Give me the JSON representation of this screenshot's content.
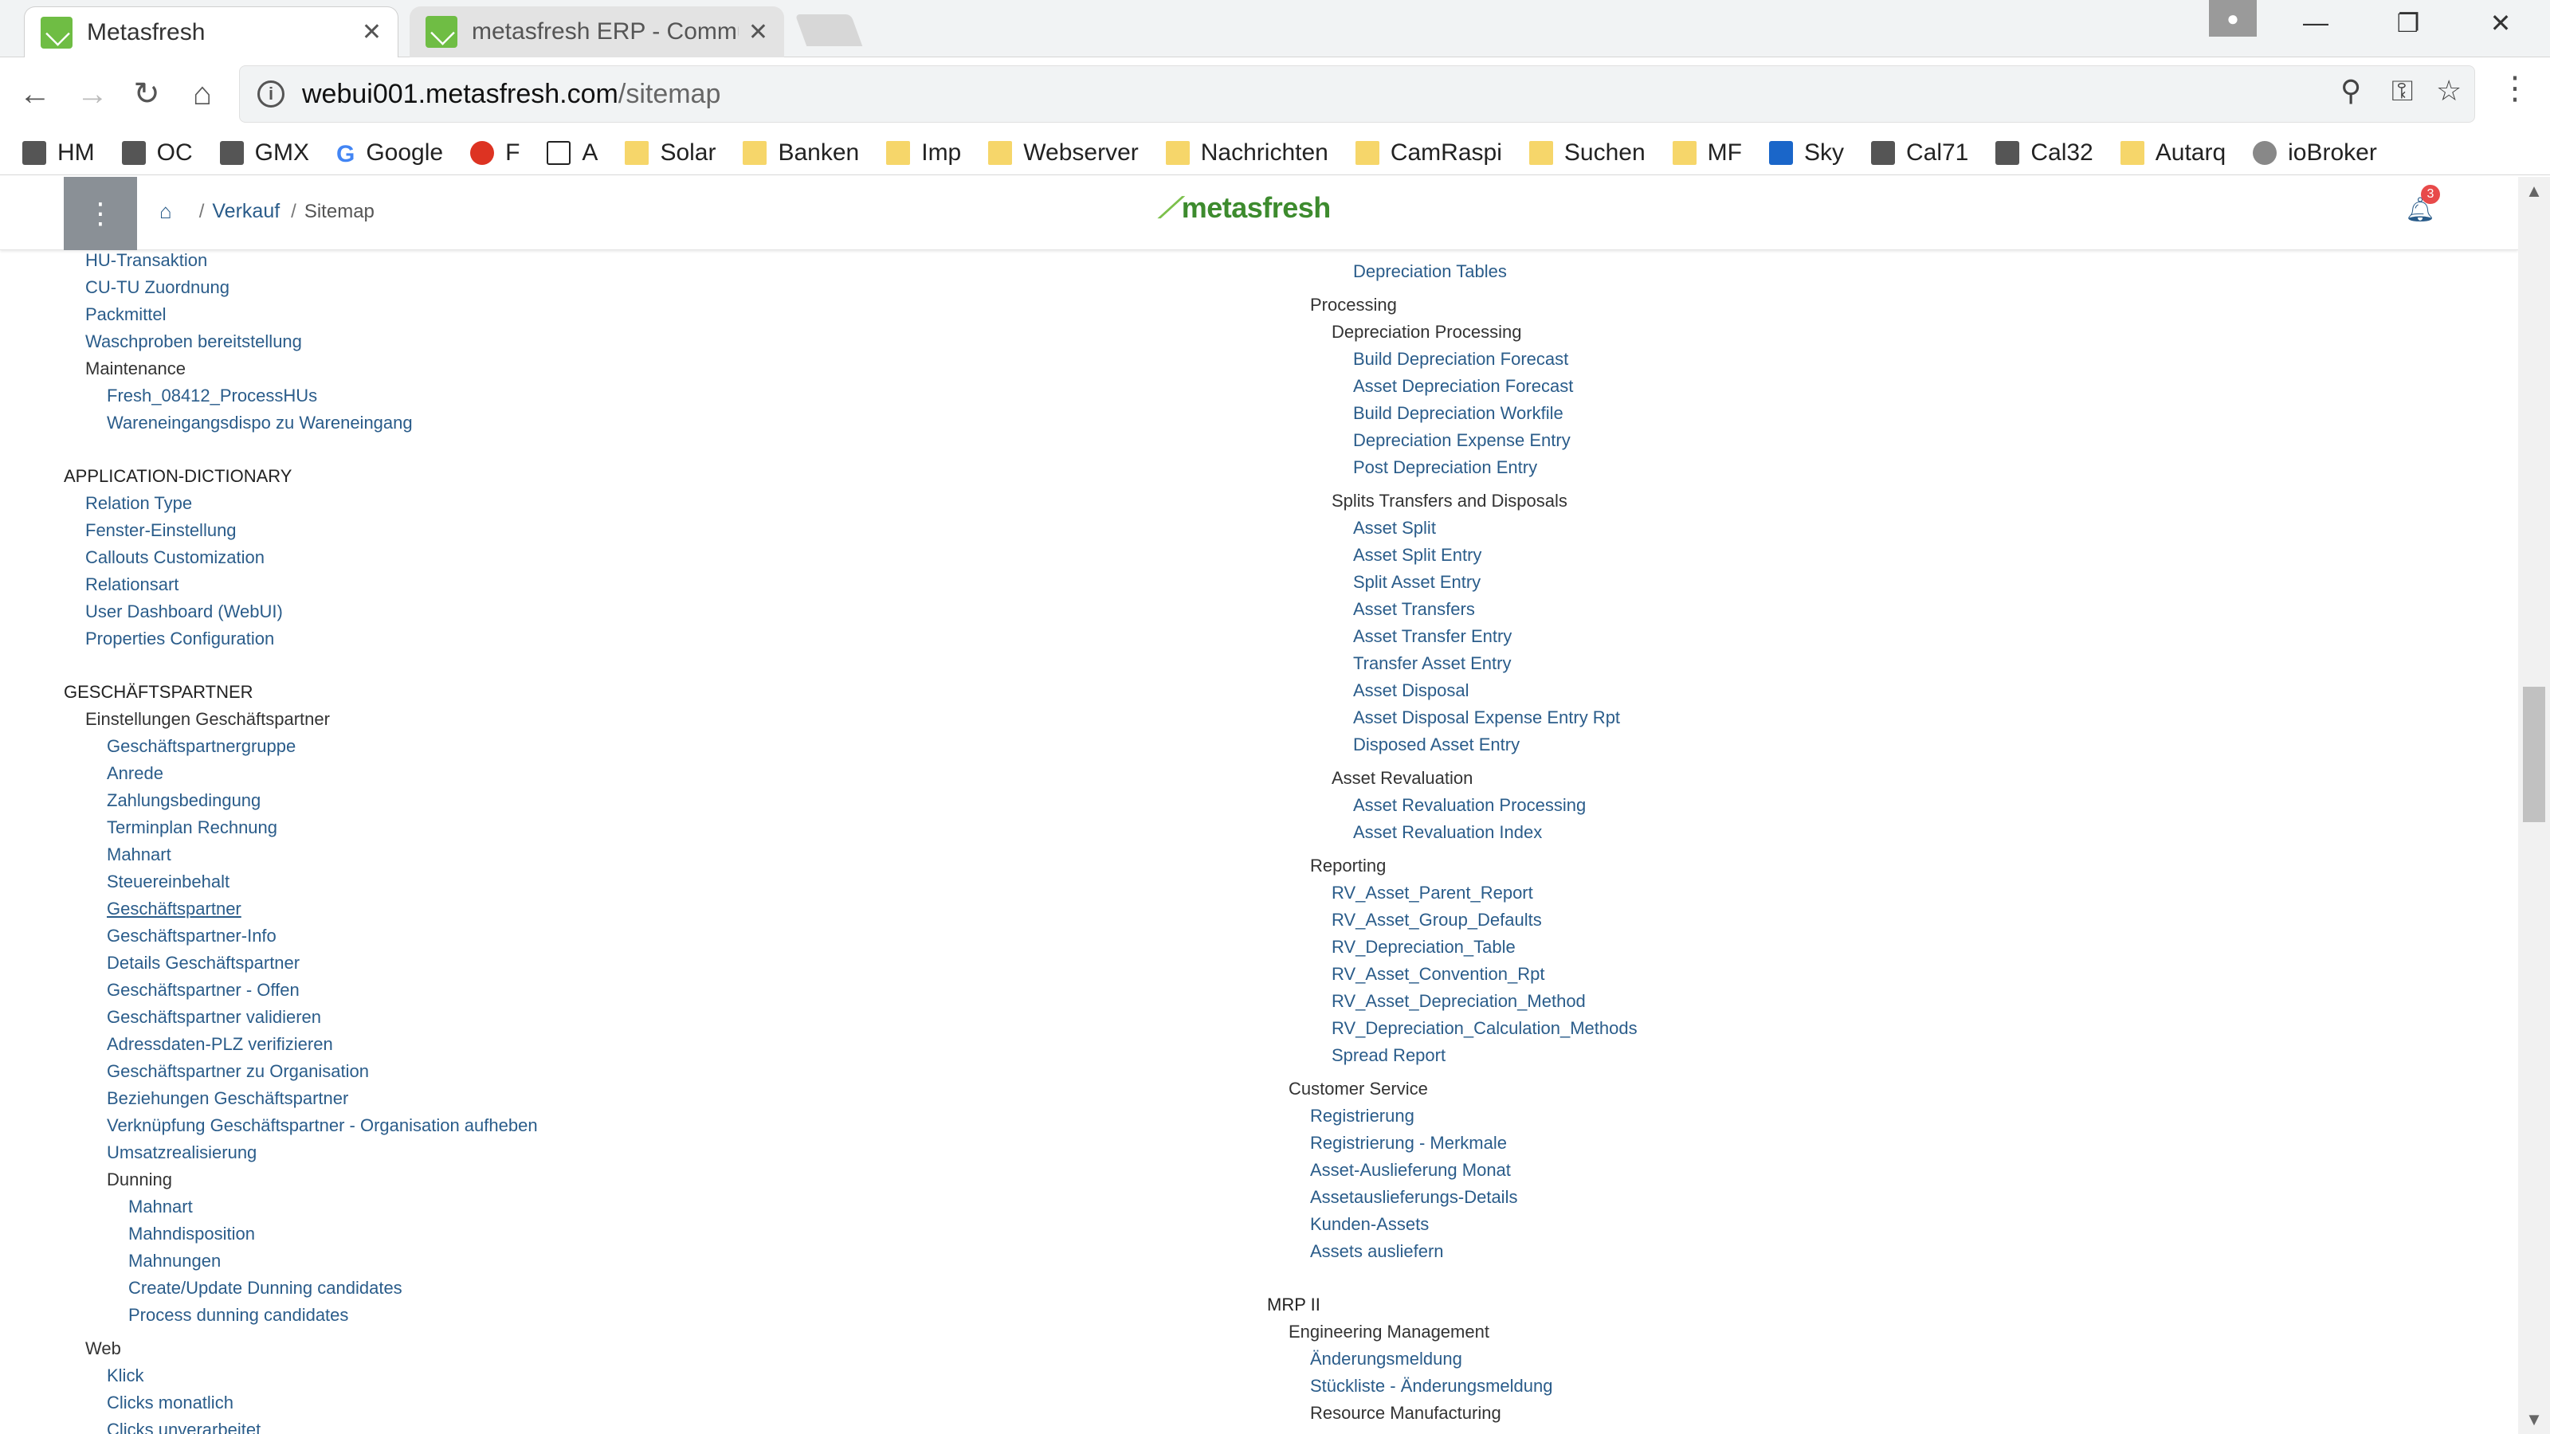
{
  "browser": {
    "tabs": [
      {
        "title": "Metasfresh"
      },
      {
        "title": "metasfresh ERP - Commu"
      }
    ],
    "url_host": "webui001.metasfresh.com",
    "url_path": "/sitemap",
    "bookmarks": [
      {
        "label": "HM",
        "icon": "file-icon"
      },
      {
        "label": "OC",
        "icon": "cloud-icon"
      },
      {
        "label": "GMX",
        "icon": "gmx-icon"
      },
      {
        "label": "Google",
        "icon": "google-icon"
      },
      {
        "label": "F",
        "icon": "fritz-icon"
      },
      {
        "label": "A",
        "icon": "amazon-icon"
      },
      {
        "label": "Solar",
        "icon": "folder-icon"
      },
      {
        "label": "Banken",
        "icon": "folder-icon"
      },
      {
        "label": "Imp",
        "icon": "folder-icon"
      },
      {
        "label": "Webserver",
        "icon": "folder-icon"
      },
      {
        "label": "Nachrichten",
        "icon": "folder-icon"
      },
      {
        "label": "CamRaspi",
        "icon": "folder-icon"
      },
      {
        "label": "Suchen",
        "icon": "folder-icon"
      },
      {
        "label": "MF",
        "icon": "folder-icon"
      },
      {
        "label": "Sky",
        "icon": "sky-icon"
      },
      {
        "label": "Cal71",
        "icon": "calibre-icon"
      },
      {
        "label": "Cal32",
        "icon": "calibre-icon"
      },
      {
        "label": "Autarq",
        "icon": "folder-icon"
      },
      {
        "label": "ioBroker",
        "icon": "gear-icon"
      }
    ]
  },
  "app": {
    "brand": "metasfresh",
    "breadcrumb": {
      "section": "Verkauf",
      "page": "Sitemap"
    },
    "notification_count": "3"
  },
  "sitemap": {
    "left": [
      {
        "t": "HU-Transaktion",
        "k": "l",
        "lvl": 1
      },
      {
        "t": "CU-TU Zuordnung",
        "k": "l",
        "lvl": 1
      },
      {
        "t": "Packmittel",
        "k": "l",
        "lvl": 1
      },
      {
        "t": "Waschproben bereitstellung",
        "k": "l",
        "lvl": 1
      },
      {
        "t": "Maintenance",
        "k": "g",
        "lvl": 1
      },
      {
        "t": "Fresh_08412_ProcessHUs",
        "k": "l",
        "lvl": 2
      },
      {
        "t": "Wareneingangsdispo zu Wareneingang",
        "k": "l",
        "lvl": 2
      },
      {
        "t": "APPLICATION-DICTIONARY",
        "k": "h",
        "lvl": 0,
        "gap": true
      },
      {
        "t": "Relation Type",
        "k": "l",
        "lvl": 1
      },
      {
        "t": "Fenster-Einstellung",
        "k": "l",
        "lvl": 1
      },
      {
        "t": "Callouts Customization",
        "k": "l",
        "lvl": 1
      },
      {
        "t": "Relationsart",
        "k": "l",
        "lvl": 1
      },
      {
        "t": "User Dashboard (WebUI)",
        "k": "l",
        "lvl": 1
      },
      {
        "t": "Properties Configuration",
        "k": "l",
        "lvl": 1
      },
      {
        "t": "GESCHÄFTSPARTNER",
        "k": "h",
        "lvl": 0,
        "gap": true
      },
      {
        "t": "Einstellungen Geschäftspartner",
        "k": "g",
        "lvl": 1
      },
      {
        "t": "Geschäftspartnergruppe",
        "k": "l",
        "lvl": 2
      },
      {
        "t": "Anrede",
        "k": "l",
        "lvl": 2
      },
      {
        "t": "Zahlungsbedingung",
        "k": "l",
        "lvl": 2
      },
      {
        "t": "Terminplan Rechnung",
        "k": "l",
        "lvl": 2
      },
      {
        "t": "Mahnart",
        "k": "l",
        "lvl": 2
      },
      {
        "t": "Steuereinbehalt",
        "k": "l",
        "lvl": 2
      },
      {
        "t": "Geschäftspartner",
        "k": "l",
        "lvl": 2,
        "u": true
      },
      {
        "t": "Geschäftspartner-Info",
        "k": "l",
        "lvl": 2
      },
      {
        "t": "Details Geschäftspartner",
        "k": "l",
        "lvl": 2
      },
      {
        "t": "Geschäftspartner - Offen",
        "k": "l",
        "lvl": 2
      },
      {
        "t": "Geschäftspartner validieren",
        "k": "l",
        "lvl": 2
      },
      {
        "t": "Adressdaten-PLZ verifizieren",
        "k": "l",
        "lvl": 2
      },
      {
        "t": "Geschäftspartner zu Organisation",
        "k": "l",
        "lvl": 2
      },
      {
        "t": "Beziehungen Geschäftspartner",
        "k": "l",
        "lvl": 2
      },
      {
        "t": "Verknüpfung Geschäftspartner - Organisation aufheben",
        "k": "l",
        "lvl": 2
      },
      {
        "t": "Umsatzrealisierung",
        "k": "l",
        "lvl": 2
      },
      {
        "t": "Dunning",
        "k": "g",
        "lvl": 2
      },
      {
        "t": "Mahnart",
        "k": "l",
        "lvl": 3
      },
      {
        "t": "Mahndisposition",
        "k": "l",
        "lvl": 3
      },
      {
        "t": "Mahnungen",
        "k": "l",
        "lvl": 3
      },
      {
        "t": "Create/Update Dunning candidates",
        "k": "l",
        "lvl": 3
      },
      {
        "t": "Process dunning candidates",
        "k": "l",
        "lvl": 3
      },
      {
        "t": "Web",
        "k": "g",
        "lvl": 1,
        "gap": "small"
      },
      {
        "t": "Klick",
        "k": "l",
        "lvl": 2
      },
      {
        "t": "Clicks monatlich",
        "k": "l",
        "lvl": 2
      },
      {
        "t": "Clicks unverarbeitet",
        "k": "l",
        "lvl": 2
      }
    ],
    "right": [
      {
        "t": "Depreciation Tables",
        "k": "l",
        "lvl": 4
      },
      {
        "t": "Processing",
        "k": "g",
        "lvl": 2,
        "gap": "small"
      },
      {
        "t": "Depreciation Processing",
        "k": "g",
        "lvl": 3
      },
      {
        "t": "Build Depreciation Forecast",
        "k": "l",
        "lvl": 4
      },
      {
        "t": "Asset Depreciation Forecast",
        "k": "l",
        "lvl": 4
      },
      {
        "t": "Build Depreciation Workfile",
        "k": "l",
        "lvl": 4
      },
      {
        "t": "Depreciation Expense Entry",
        "k": "l",
        "lvl": 4
      },
      {
        "t": "Post Depreciation Entry",
        "k": "l",
        "lvl": 4
      },
      {
        "t": "Splits Transfers and Disposals",
        "k": "g",
        "lvl": 3,
        "gap": "small"
      },
      {
        "t": "Asset Split",
        "k": "l",
        "lvl": 4
      },
      {
        "t": "Asset Split Entry",
        "k": "l",
        "lvl": 4
      },
      {
        "t": "Split Asset Entry",
        "k": "l",
        "lvl": 4
      },
      {
        "t": "Asset Transfers",
        "k": "l",
        "lvl": 4
      },
      {
        "t": "Asset Transfer Entry",
        "k": "l",
        "lvl": 4
      },
      {
        "t": "Transfer Asset Entry",
        "k": "l",
        "lvl": 4
      },
      {
        "t": "Asset Disposal",
        "k": "l",
        "lvl": 4
      },
      {
        "t": "Asset Disposal Expense Entry Rpt",
        "k": "l",
        "lvl": 4
      },
      {
        "t": "Disposed Asset Entry",
        "k": "l",
        "lvl": 4
      },
      {
        "t": "Asset Revaluation",
        "k": "g",
        "lvl": 3,
        "gap": "small"
      },
      {
        "t": "Asset Revaluation Processing",
        "k": "l",
        "lvl": 4
      },
      {
        "t": "Asset Revaluation Index",
        "k": "l",
        "lvl": 4
      },
      {
        "t": "Reporting",
        "k": "g",
        "lvl": 2,
        "gap": "small"
      },
      {
        "t": "RV_Asset_Parent_Report",
        "k": "l",
        "lvl": 3
      },
      {
        "t": "RV_Asset_Group_Defaults",
        "k": "l",
        "lvl": 3
      },
      {
        "t": "RV_Depreciation_Table",
        "k": "l",
        "lvl": 3
      },
      {
        "t": "RV_Asset_Convention_Rpt",
        "k": "l",
        "lvl": 3
      },
      {
        "t": "RV_Asset_Depreciation_Method",
        "k": "l",
        "lvl": 3
      },
      {
        "t": "RV_Depreciation_Calculation_Methods",
        "k": "l",
        "lvl": 3
      },
      {
        "t": "Spread Report",
        "k": "l",
        "lvl": 3
      },
      {
        "t": "Customer Service",
        "k": "g",
        "lvl": 1,
        "gap": "small"
      },
      {
        "t": "Registrierung",
        "k": "l",
        "lvl": 2
      },
      {
        "t": "Registrierung - Merkmale",
        "k": "l",
        "lvl": 2
      },
      {
        "t": "Asset-Auslieferung Monat",
        "k": "l",
        "lvl": 2
      },
      {
        "t": "Assetauslieferungs-Details",
        "k": "l",
        "lvl": 2
      },
      {
        "t": "Kunden-Assets",
        "k": "l",
        "lvl": 2
      },
      {
        "t": "Assets ausliefern",
        "k": "l",
        "lvl": 2
      },
      {
        "t": "MRP II",
        "k": "h",
        "lvl": 0,
        "gap": true
      },
      {
        "t": "Engineering Management",
        "k": "g",
        "lvl": 1
      },
      {
        "t": "Änderungsmeldung",
        "k": "l",
        "lvl": 2
      },
      {
        "t": "Stückliste - Änderungsmeldung",
        "k": "l",
        "lvl": 2
      },
      {
        "t": "Resource Manufacturing",
        "k": "g",
        "lvl": 2
      }
    ]
  },
  "colors": {
    "link": "#2a5c8a",
    "brand": "#3d8b2e",
    "badge": "#e84a4a"
  }
}
